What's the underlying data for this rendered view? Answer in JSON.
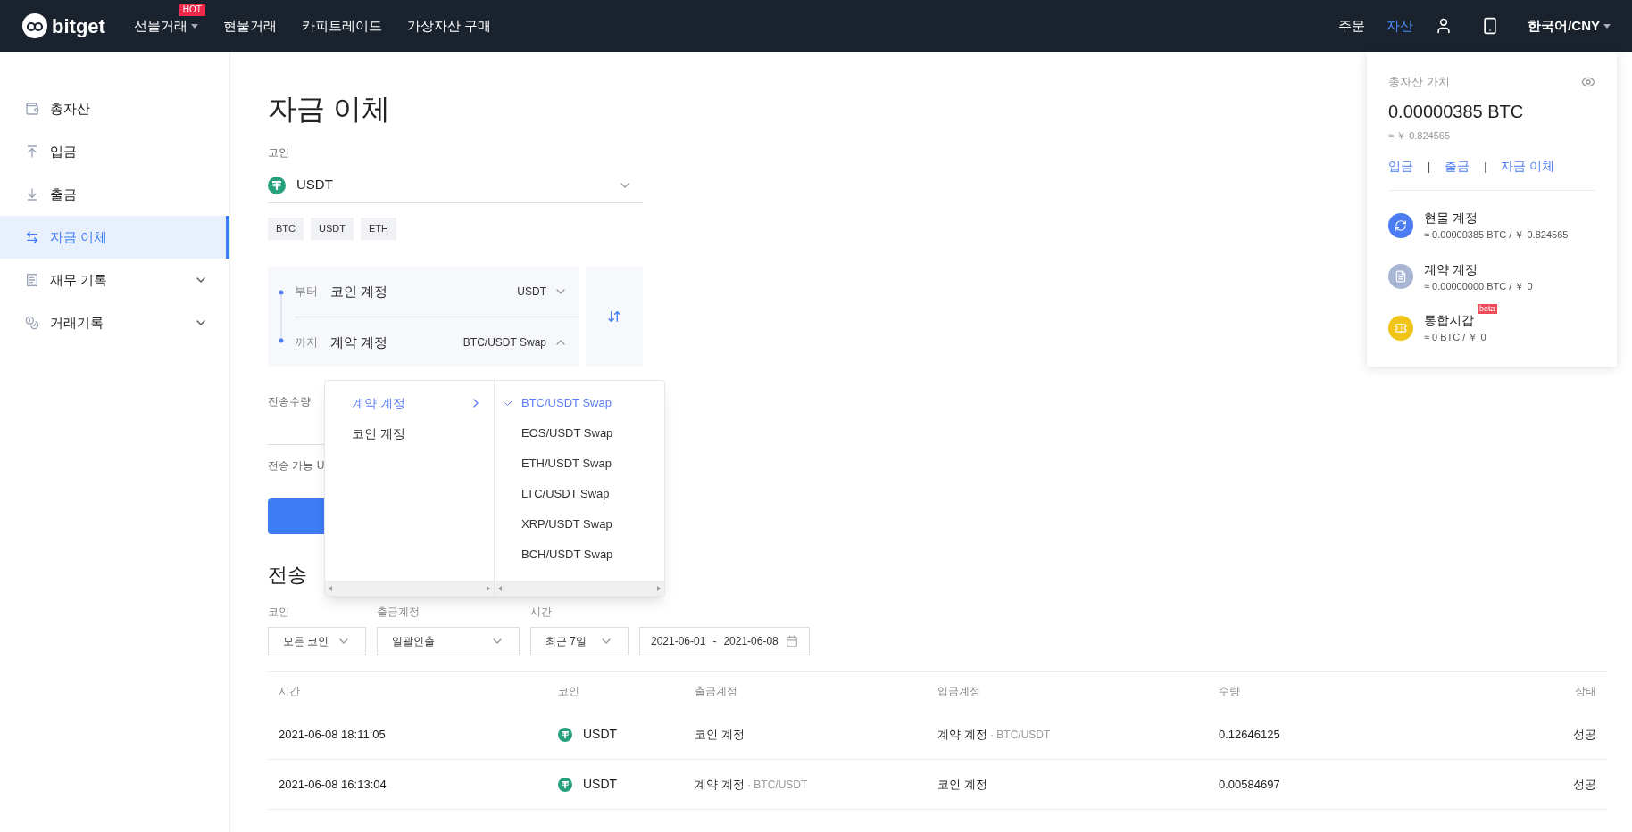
{
  "header": {
    "logo": "bitget",
    "nav": [
      {
        "label": "선물거래",
        "badge": "HOT",
        "dropdown": true
      },
      {
        "label": "현물거래",
        "dropdown": false
      },
      {
        "label": "카피트레이드",
        "dropdown": false
      },
      {
        "label": "가상자산 구매",
        "dropdown": false
      }
    ],
    "right_links": [
      {
        "label": "주문",
        "selected": false
      },
      {
        "label": "자산",
        "selected": true
      }
    ],
    "language": "한국어/CNY"
  },
  "sidebar": {
    "items": [
      {
        "label": "총자산",
        "selected": false
      },
      {
        "label": "입금",
        "selected": false
      },
      {
        "label": "출금",
        "selected": false
      },
      {
        "label": "자금 이체",
        "selected": true
      },
      {
        "label": "재무 기록",
        "selected": false,
        "expanded": false
      },
      {
        "label": "거래기록",
        "selected": false,
        "expanded": false
      }
    ]
  },
  "transfer": {
    "title": "자금 이체",
    "coin_label": "코인",
    "coin": "USDT",
    "quick_coins": [
      "BTC",
      "USDT",
      "ETH"
    ],
    "from": {
      "label": "부터",
      "account": "코인 계정",
      "detail": "USDT",
      "open": false
    },
    "to": {
      "label": "까지",
      "account": "계약 계정",
      "detail": "BTC/USDT Swap",
      "open": true
    },
    "amount_label": "전송수량",
    "available": "전송 가능 U"
  },
  "dropdown": {
    "accounts": [
      {
        "label": "계약 계정",
        "selected": true
      },
      {
        "label": "코인 계정",
        "selected": false
      }
    ],
    "pairs": [
      {
        "label": "BTC/USDT Swap",
        "selected": true
      },
      {
        "label": "EOS/USDT Swap",
        "selected": false
      },
      {
        "label": "ETH/USDT Swap",
        "selected": false
      },
      {
        "label": "LTC/USDT Swap",
        "selected": false
      },
      {
        "label": "XRP/USDT Swap",
        "selected": false
      },
      {
        "label": "BCH/USDT Swap",
        "selected": false
      }
    ]
  },
  "history": {
    "title": "전송",
    "filters": [
      {
        "label": "코인",
        "value": "모든 코인",
        "kind": "select"
      },
      {
        "label": "출금계정",
        "value": "일괄인출",
        "kind": "select"
      },
      {
        "label": "시간",
        "value": "최근 7일",
        "kind": "select"
      },
      {
        "start": "2021-06-01",
        "separator": "-",
        "end": "2021-06-08",
        "kind": "date"
      }
    ],
    "columns": [
      "시간",
      "코인",
      "출금계정",
      "입금계정",
      "수량",
      "상태"
    ],
    "rows": [
      {
        "time": "2021-06-08 18:11:05",
        "coin": "USDT",
        "from": "코인 계정",
        "from_detail": "",
        "to": "계약 계정",
        "to_detail": "· BTC/USDT",
        "amount": "0.12646125",
        "status": "성공"
      },
      {
        "time": "2021-06-08 16:13:04",
        "coin": "USDT",
        "from": "계약 계정",
        "from_detail": "· BTC/USDT",
        "to": "코인 계정",
        "to_detail": "",
        "amount": "0.00584697",
        "status": "성공"
      }
    ]
  },
  "assets_panel": {
    "title": "총자산 가치",
    "total": "0.00000385 BTC",
    "approx": "≈ ￥ 0.824565",
    "links": [
      "입금",
      "출금",
      "자금 이체"
    ],
    "link_separator": "|",
    "accounts": [
      {
        "name": "현물 계정",
        "value": "≈ 0.00000385 BTC / ￥ 0.824565",
        "color": "#4c7cf3"
      },
      {
        "name": "계약 계정",
        "value": "≈ 0.00000000 BTC / ￥ 0",
        "color": "#a9b6d3"
      },
      {
        "name": "통합지갑",
        "value": "≈ 0 BTC / ￥ 0",
        "color": "#f0c419",
        "badge": "beta"
      }
    ]
  }
}
